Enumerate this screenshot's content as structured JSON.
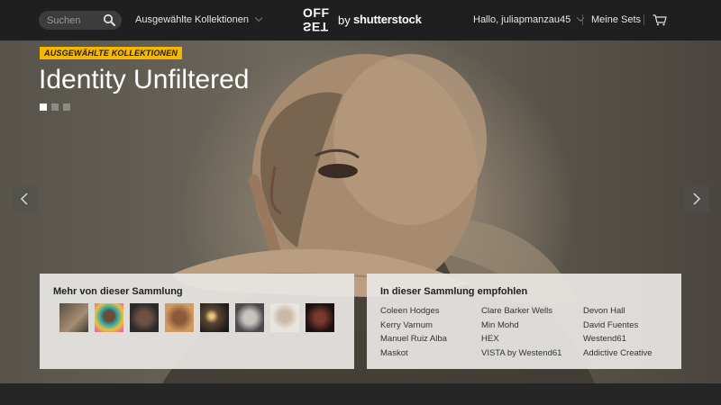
{
  "header": {
    "search_placeholder": "Suchen",
    "collections_menu": "Ausgewählte Kollektionen",
    "logo": {
      "grid_top": "OFF",
      "grid_bottom": "SET",
      "by": "by",
      "brand": "shutterstock"
    },
    "greeting": "Hallo, juliapmanzau45",
    "my_sets": "Meine Sets"
  },
  "hero": {
    "badge": "AUSGEWÄHLTE KOLLEKTIONEN",
    "title": "Identity Unfiltered",
    "slides": [
      true,
      false,
      false
    ]
  },
  "more_from_collection": {
    "title": "Mehr von dieser Sammlung",
    "thumbnails": [
      "portrait-sepia",
      "portrait-colorful-hair",
      "portrait-close-up",
      "portrait-warm",
      "portrait-dark-light",
      "portrait-pale-grey",
      "portrait-bald-light",
      "portrait-dark-red"
    ]
  },
  "recommended": {
    "title": "In dieser Sammlung empfohlen",
    "columns": [
      [
        "Coleen Hodges",
        "Kerry Varnum",
        "Manuel Ruiz Alba",
        "Maskot"
      ],
      [
        "Clare Barker Wells",
        "Min Mohd",
        "HEX",
        "VISTA by Westend61"
      ],
      [
        "Devon Hall",
        "David Fuentes",
        "Westend61",
        "Addictive Creative"
      ]
    ]
  },
  "colors": {
    "accent": "#f5b700",
    "header_bg": "#1f1f1f",
    "panel_bg": "#e8e6e3"
  }
}
